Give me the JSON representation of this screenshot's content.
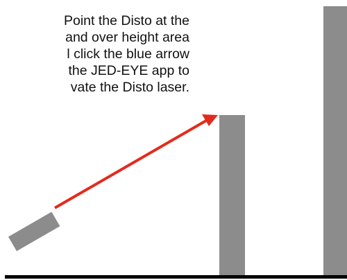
{
  "instructions": {
    "lines": [
      "Point the Disto at the",
      "and over height area",
      "l click the blue arrow",
      "the JED-EYE app to",
      "vate the Disto laser."
    ]
  },
  "colors": {
    "text": "#111111",
    "device": "#8c8c8c",
    "pillar": "#8c8c8c",
    "laser_arrow": "#e42a1d",
    "ground": "#000000"
  },
  "icons": {
    "device": "disto-device",
    "laser": "laser-arrow"
  }
}
